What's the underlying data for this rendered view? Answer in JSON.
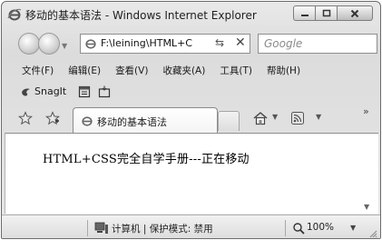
{
  "window": {
    "title": "移动的基本语法 - Windows Internet Explorer",
    "controls": {
      "minimize": "minimize",
      "maximize": "maximize",
      "close": "close"
    }
  },
  "address_bar": {
    "url": "F:\\leining\\HTML+C",
    "search_placeholder": "Google"
  },
  "menu": {
    "items": [
      "文件(F)",
      "编辑(E)",
      "查看(V)",
      "收藏夹(A)",
      "工具(T)",
      "帮助(H)"
    ]
  },
  "snagit": {
    "label": "SnagIt"
  },
  "tabs": {
    "active_label": "移动的基本语法"
  },
  "content": {
    "text": "HTML+CSS完全自学手册---正在移动"
  },
  "status": {
    "zone": "计算机 | 保护模式: 禁用",
    "zoom": "100%"
  },
  "icons": {
    "title": "ie-logo-icon",
    "favorites": "star-icon",
    "add_favorite": "add-favorite-icon",
    "home": "home-icon",
    "feeds": "feeds-icon"
  }
}
